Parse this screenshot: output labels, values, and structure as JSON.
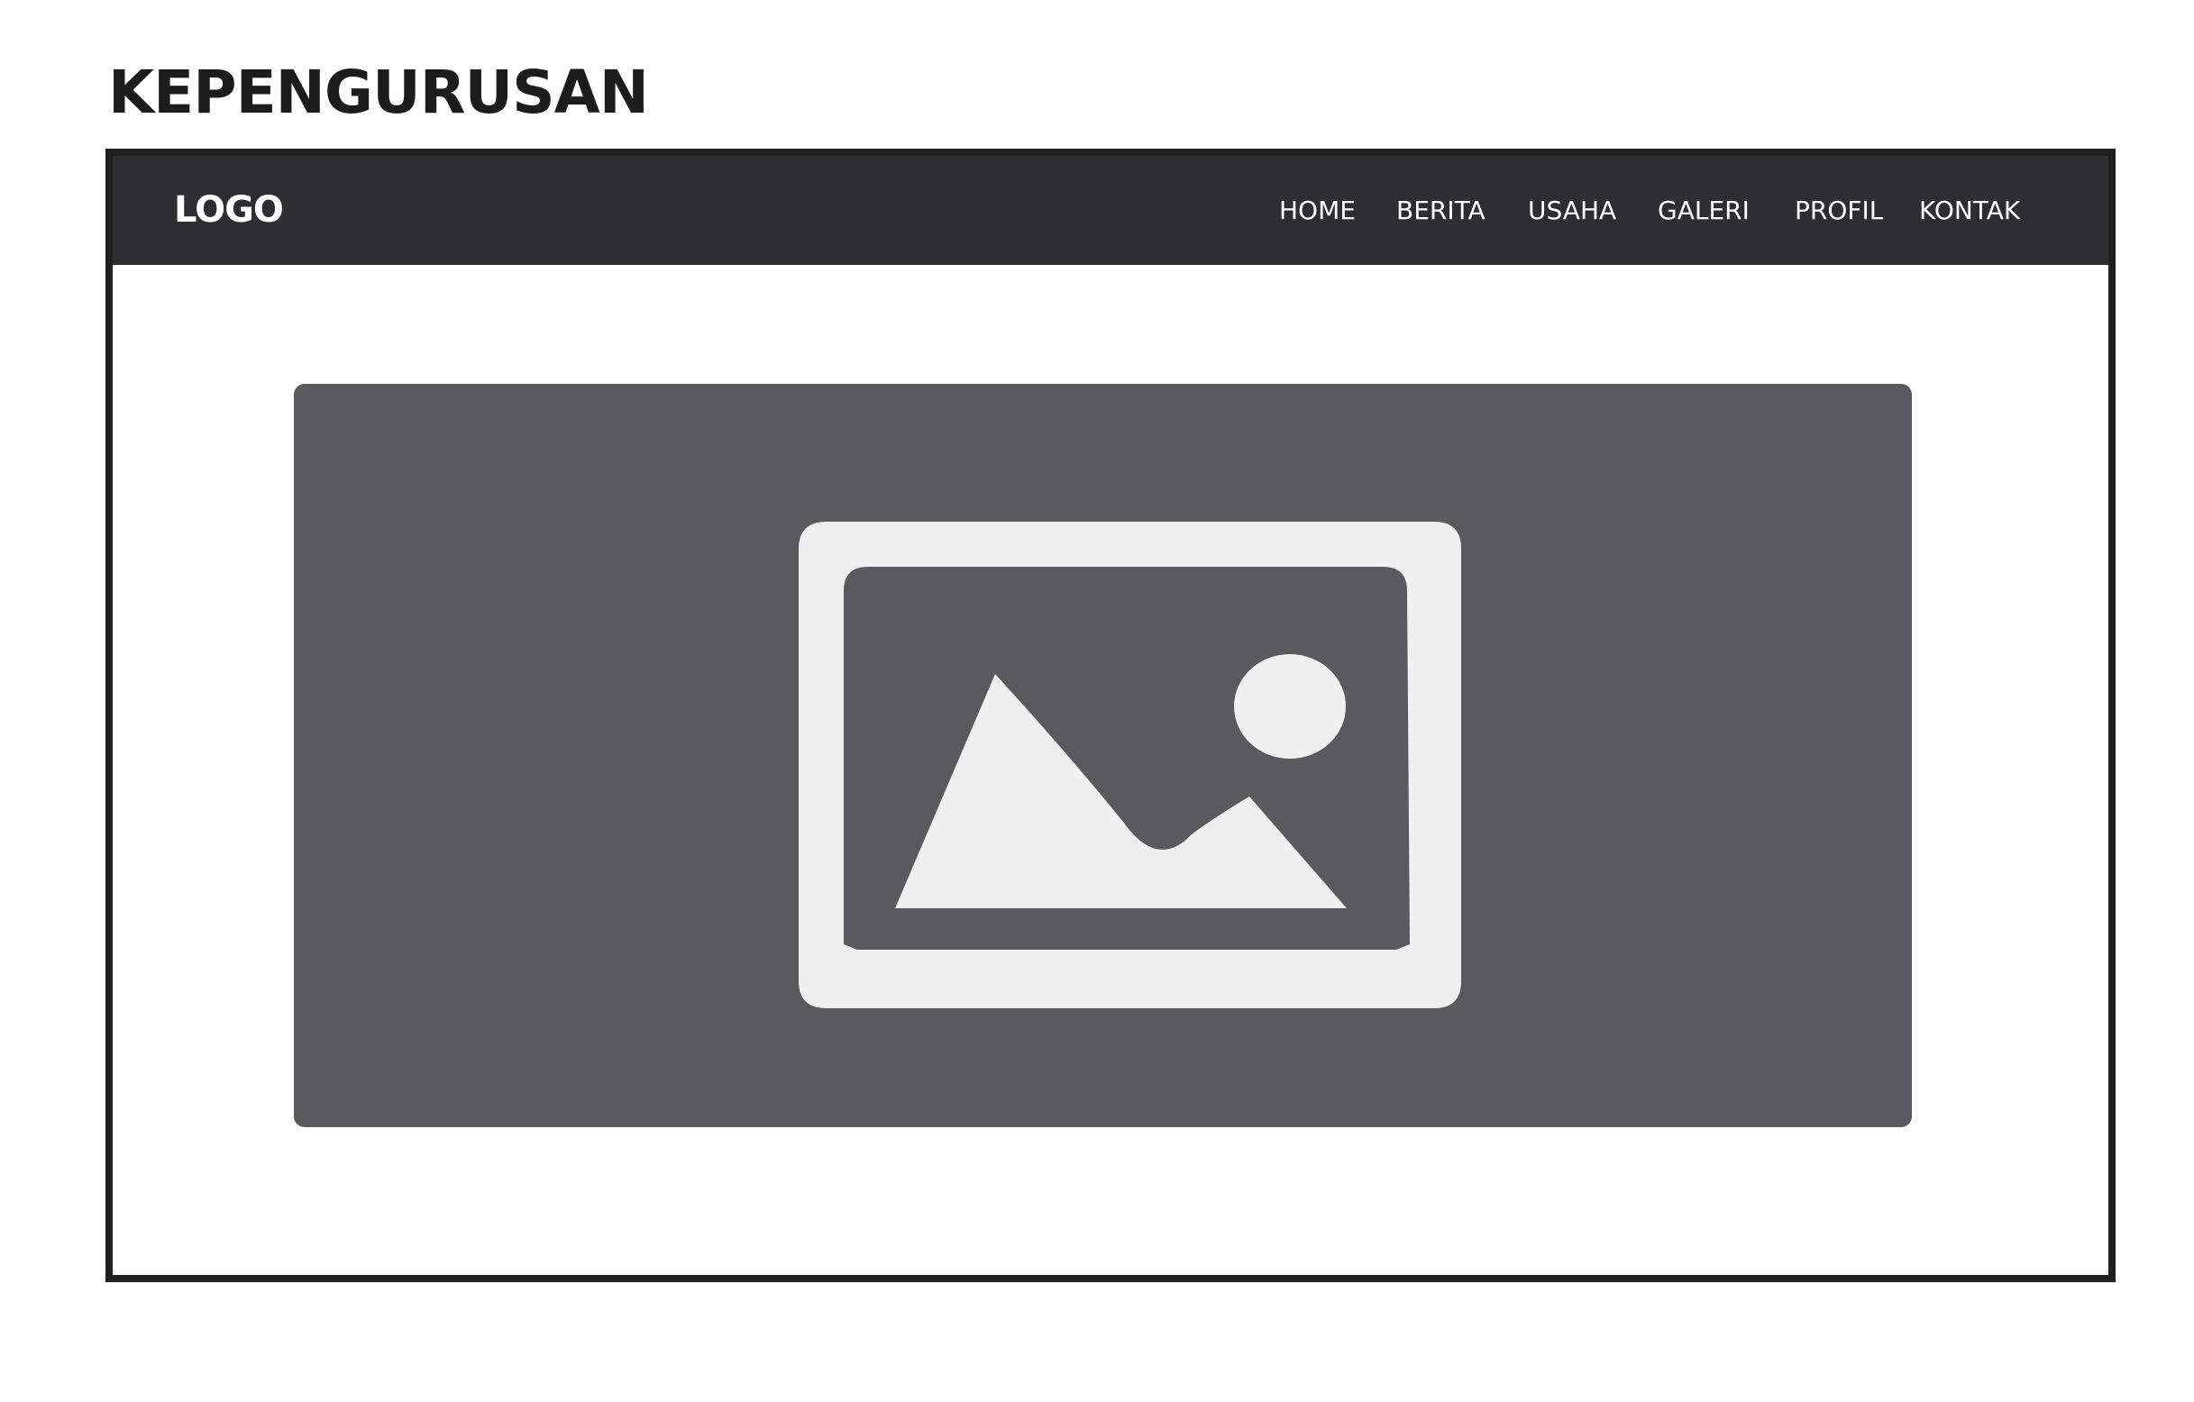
{
  "page": {
    "heading": "KEPENGURUSAN"
  },
  "navbar": {
    "logo": "LOGO",
    "items": [
      {
        "label": "HOME"
      },
      {
        "label": "BERITA"
      },
      {
        "label": "USAHA"
      },
      {
        "label": "GALERI"
      },
      {
        "label": "PROFIL"
      },
      {
        "label": "KONTAK"
      }
    ]
  },
  "hero": {
    "icon": "image-placeholder-icon"
  },
  "colors": {
    "navbar_bg": "#2e2e30",
    "frame_border": "#1f1f20",
    "placeholder_bg": "#5a5a5c",
    "icon_fill": "#f0f0f0"
  }
}
